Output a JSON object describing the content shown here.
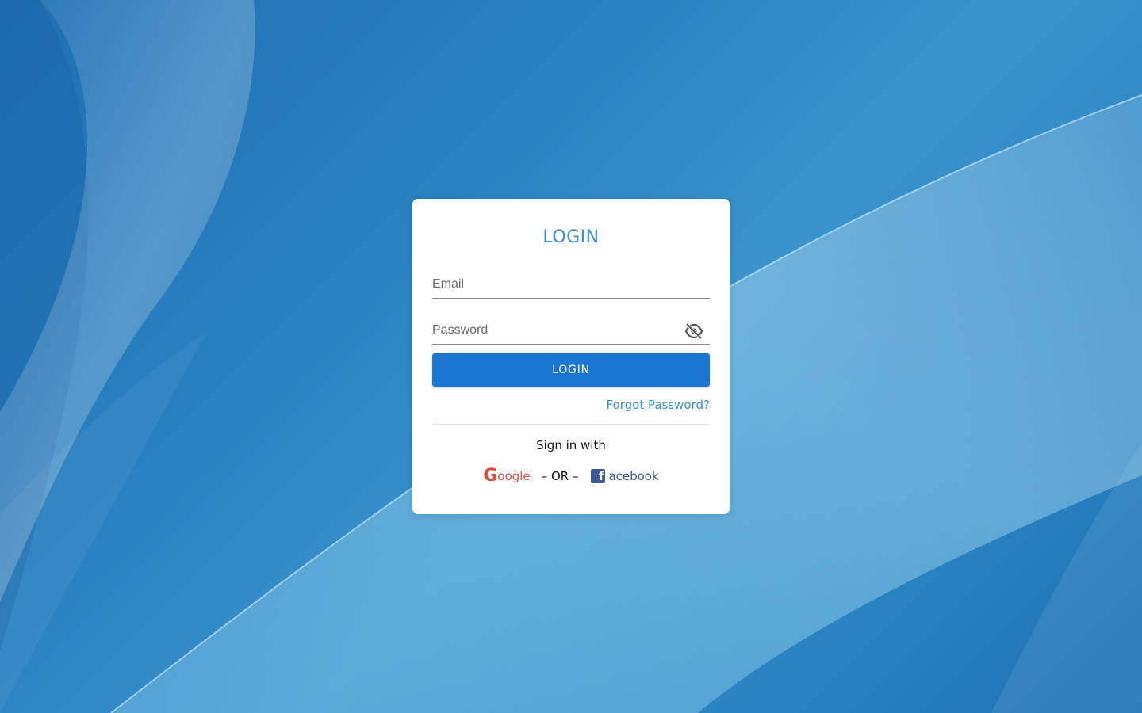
{
  "login": {
    "title": "LOGIN",
    "email_placeholder": "Email",
    "password_placeholder": "Password",
    "login_button": "LOGIN",
    "forgot_password": "Forgot Password?",
    "sign_in_with": "Sign in with",
    "google_label": "oogle",
    "google_icon_letter": "G",
    "or_separator": "– OR –",
    "facebook_label": "acebook",
    "facebook_icon_letter": "f"
  },
  "icons": {
    "password_toggle": "eye-off-icon"
  },
  "colors": {
    "primary": "#1b76d2",
    "accent": "#3a90c8",
    "google": "#dd4b3e",
    "facebook": "#3b5998"
  }
}
